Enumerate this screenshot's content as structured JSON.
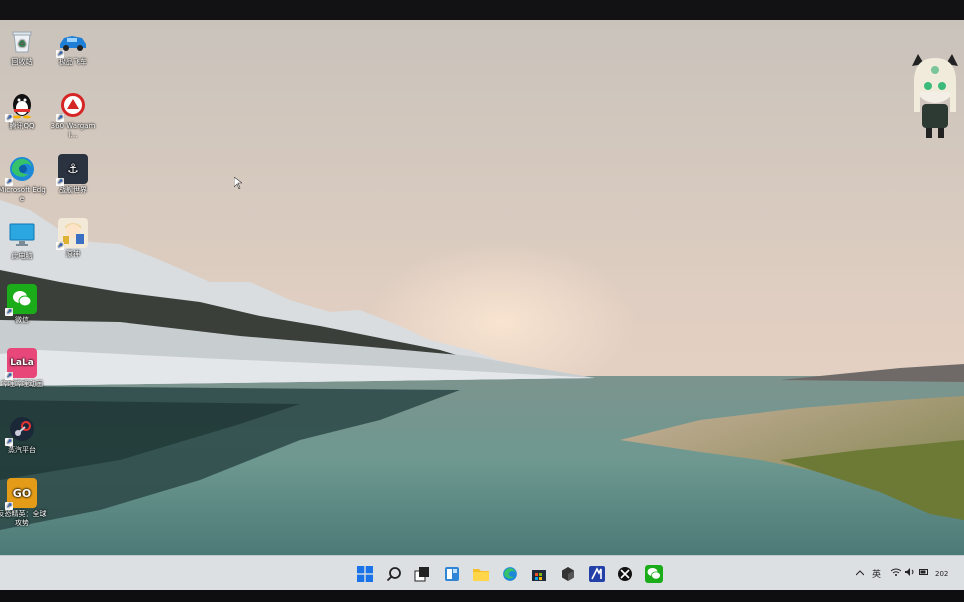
{
  "desktop": {
    "icons": [
      {
        "id": "recycle",
        "label": "回收站",
        "symbol": "♻"
      },
      {
        "id": "racing",
        "label": "极品飞车",
        "symbol": ""
      },
      {
        "id": "qq",
        "label": "腾讯QQ",
        "symbol": ""
      },
      {
        "id": "wargaming",
        "label": "360 Wargami...",
        "symbol": ""
      },
      {
        "id": "edge",
        "label": "Microsoft Edge",
        "symbol": ""
      },
      {
        "id": "warships",
        "label": "战舰世界",
        "symbol": "⚓"
      },
      {
        "id": "pc",
        "label": "此电脑",
        "symbol": ""
      },
      {
        "id": "genshin",
        "label": "原神",
        "symbol": ""
      },
      {
        "id": "wechat",
        "label": "微信",
        "symbol": ""
      },
      {
        "id": "lala",
        "label": "哔哩哔哩动画",
        "symbol": "LaLa"
      },
      {
        "id": "steam",
        "label": "蒸汽平台",
        "symbol": ""
      },
      {
        "id": "csgo",
        "label": "反恐精英：全球攻势",
        "symbol": "GO"
      }
    ]
  },
  "taskbar": {
    "buttons": [
      "start",
      "search",
      "task-view",
      "widgets",
      "file-explorer",
      "edge",
      "store",
      "app-cube",
      "app-blue",
      "xbox",
      "wechat"
    ],
    "tray": {
      "ime": "英",
      "time_fragment": "202"
    }
  },
  "colors": {
    "sky_top": "#cfc7bd",
    "sky_bottom": "#e6cdbd",
    "water": "#5f8880",
    "taskbar": "#dde0e3",
    "start_blue": "#1a73e8"
  }
}
